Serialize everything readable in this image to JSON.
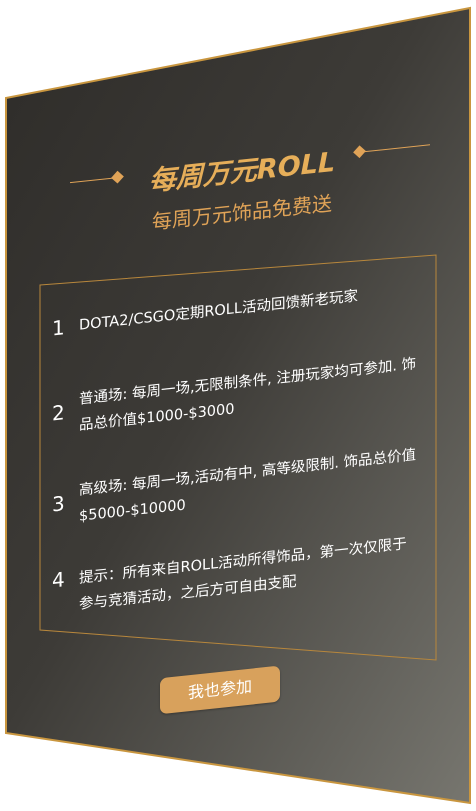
{
  "header": {
    "title": "每周万元ROLL",
    "subtitle": "每周万元饰品免费送"
  },
  "rules": [
    {
      "number": "1",
      "text": "DOTA2/CSGO定期ROLL活动回馈新老玩家"
    },
    {
      "number": "2",
      "text": "普通场:  每周一场,无限制条件, 注册玩家均可参加. 饰品总价值$1000-$3000"
    },
    {
      "number": "3",
      "text": "高级场:  每周一场,活动有中, 高等级限制. 饰品总价值$5000-$10000"
    },
    {
      "number": "4",
      "text": "提示：所有来自ROLL活动所得饰品，第一次仅限于参与竞猜活动，之后方可自由支配"
    }
  ],
  "join_button": {
    "label": "我也参加"
  },
  "colors": {
    "accent_gold": "#e6ae59",
    "button": "#d8a15c",
    "card_dark": "#3a3834",
    "card_light": "#6a6963",
    "text": "#ffffff"
  }
}
